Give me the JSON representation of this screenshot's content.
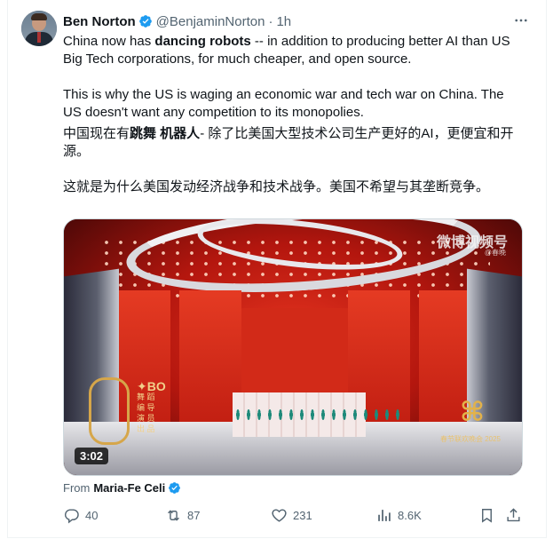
{
  "author": {
    "name": "Ben Norton",
    "handle": "@BenjaminNorton",
    "separator": "·",
    "time": "1h"
  },
  "tweet": {
    "p1_a": "China now has ",
    "p1_bold": "dancing robots",
    "p1_b": " -- in addition to producing better AI than US Big Tech corporations, for much cheaper, and open source.",
    "p2": "This is why the US is waging an economic war and tech war on China. The US doesn't want any competition to its monopolies.",
    "p3_a": "中国现在有",
    "p3_bold": "跳舞 机器人",
    "p3_b": "- 除了比美国大型技术公司生产更好的AI，更便宜和开源。",
    "p4": "这就是为什么美国发动经济战争和技术战争。美国不希望与其垄断竞争。"
  },
  "media": {
    "duration": "3:02",
    "watermark": "微博视频号",
    "watermark_sub": "@春晚",
    "credit_title": "✦BO",
    "credit_lines": [
      "舞 蹈",
      "编 导",
      "演 员",
      "出 品"
    ],
    "corner_text": "春节联欢晚会 2025"
  },
  "from": {
    "label": "From",
    "name": "Maria-Fe Celi"
  },
  "actions": {
    "replies": "40",
    "reposts": "87",
    "likes": "231",
    "views": "8.6K"
  },
  "colors": {
    "verified": "#1d9bf0",
    "secondary": "#536471",
    "text": "#0f1419"
  }
}
